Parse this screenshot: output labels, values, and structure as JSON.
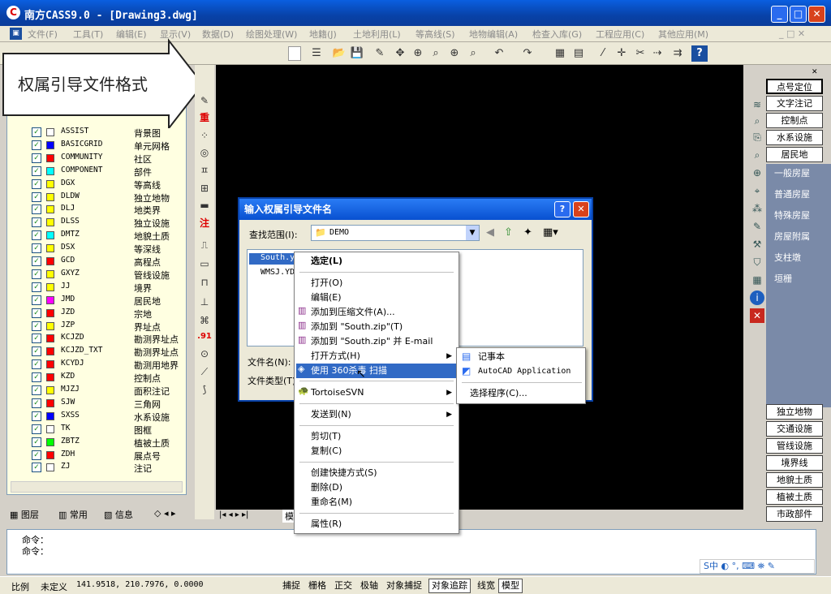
{
  "window": {
    "title": "南方CASS9.0 - [Drawing3.dwg]",
    "min": "_",
    "max": "□",
    "close": "✕"
  },
  "menubar": [
    "文件(F)",
    "工具(T)",
    "编辑(E)",
    "显示(V)",
    "数据(D)",
    "绘图处理(W)",
    "地籍(J)",
    "土地利用(L)",
    "等高线(S)",
    "地物编辑(A)",
    "检查入库(G)",
    "工程应用(C)",
    "其他应用(M)"
  ],
  "callout": {
    "text": "权属引导文件格式"
  },
  "layers": [
    {
      "code": "ASSIST",
      "name": "背景图",
      "color": "#ffffff"
    },
    {
      "code": "BASICGRID",
      "name": "单元网格",
      "color": "#0000ff"
    },
    {
      "code": "COMMUNITY",
      "name": "社区",
      "color": "#ff0000"
    },
    {
      "code": "COMPONENT",
      "name": "部件",
      "color": "#00ffff"
    },
    {
      "code": "DGX",
      "name": "等高线",
      "color": "#ffff00"
    },
    {
      "code": "DLDW",
      "name": "独立地物",
      "color": "#ffff00"
    },
    {
      "code": "DLJ",
      "name": "地类界",
      "color": "#ffff00"
    },
    {
      "code": "DLSS",
      "name": "独立设施",
      "color": "#ffff00"
    },
    {
      "code": "DMTZ",
      "name": "地貌土质",
      "color": "#00ffff"
    },
    {
      "code": "DSX",
      "name": "等深线",
      "color": "#ffff00"
    },
    {
      "code": "GCD",
      "name": "高程点",
      "color": "#ff0000"
    },
    {
      "code": "GXYZ",
      "name": "管线设施",
      "color": "#ffff00"
    },
    {
      "code": "JJ",
      "name": "境界",
      "color": "#ffff00"
    },
    {
      "code": "JMD",
      "name": "居民地",
      "color": "#ff00ff"
    },
    {
      "code": "JZD",
      "name": "宗地",
      "color": "#ff0000"
    },
    {
      "code": "JZP",
      "name": "界址点",
      "color": "#ffff00"
    },
    {
      "code": "KCJZD",
      "name": "勘测界址点",
      "color": "#ff0000"
    },
    {
      "code": "KCJZD_TXT",
      "name": "勘测界址点",
      "color": "#ff0000"
    },
    {
      "code": "KCYDJ",
      "name": "勘测用地界",
      "color": "#ff0000"
    },
    {
      "code": "KZD",
      "name": "控制点",
      "color": "#ff0000"
    },
    {
      "code": "MJZJ",
      "name": "面积注记",
      "color": "#ffff00"
    },
    {
      "code": "SJW",
      "name": "三角网",
      "color": "#ff0000"
    },
    {
      "code": "SXSS",
      "name": "水系设施",
      "color": "#0000ff"
    },
    {
      "code": "TK",
      "name": "图框",
      "color": "#ffffff"
    },
    {
      "code": "ZBTZ",
      "name": "植被土质",
      "color": "#00ff00"
    },
    {
      "code": "ZDH",
      "name": "展点号",
      "color": "#ff0000"
    },
    {
      "code": "ZJ",
      "name": "注记",
      "color": "#ffffff"
    }
  ],
  "panel_tabs": [
    "图层",
    "常用",
    "信息"
  ],
  "vtool": [
    "重",
    "注",
    ".91"
  ],
  "right_buttons_top": [
    "点号定位",
    "文字注记",
    "控制点",
    "水系设施",
    "居民地"
  ],
  "right_sub": [
    "一般房屋",
    "普通房屋",
    "特殊房屋",
    "房屋附属",
    "支柱墩",
    "垣栅"
  ],
  "right_buttons_bottom": [
    "独立地物",
    "交通设施",
    "管线设施",
    "境界线",
    "地貌土质",
    "植被土质",
    "市政部件"
  ],
  "dialog": {
    "title": "输入权属引导文件名",
    "lookin_label": "查找范围(I):",
    "lookin_value": "DEMO",
    "files": [
      "South.yd",
      "WMSJ.YD"
    ],
    "filename_label": "文件名(N):",
    "filetype_label": "文件类型(T):"
  },
  "context_menu": [
    "选定(L)",
    "打开(O)",
    "编辑(E)",
    "添加到压缩文件(A)...",
    "添加到 \"South.zip\"(T)",
    "添加到 \"South.zip\" 并 E-mail",
    "打开方式(H)",
    "使用 360杀毒 扫描",
    "TortoiseSVN",
    "发送到(N)",
    "剪切(T)",
    "复制(C)",
    "创建快捷方式(S)",
    "删除(D)",
    "重命名(M)",
    "属性(R)"
  ],
  "open_with_menu": [
    "记事本",
    "AutoCAD Application",
    "选择程序(C)..."
  ],
  "command": {
    "line1": "命令：",
    "line2": "命令："
  },
  "status": {
    "scale": "比例",
    "scale_val": "未定义",
    "coords": "141.9518, 210.7976, 0.0000",
    "buttons": [
      "捕捉",
      "栅格",
      "正交",
      "极轴",
      "对象捕捉",
      "对象追踪",
      "线宽",
      "模型"
    ]
  },
  "ime": {
    "label": "S中"
  },
  "model_tab": "模"
}
